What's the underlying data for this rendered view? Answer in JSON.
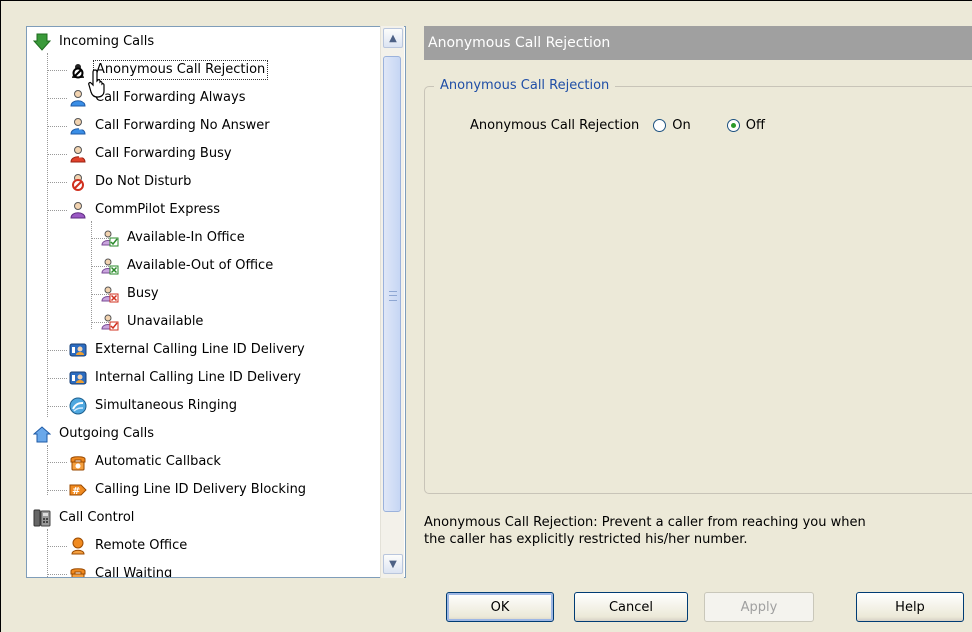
{
  "tree": {
    "items": [
      {
        "label": "Incoming Calls",
        "icon": "green-down-arrow-icon",
        "level": 0
      },
      {
        "label": "Anonymous Call Rejection",
        "icon": "anonymous-call-rejection-icon",
        "level": 1,
        "selected": true
      },
      {
        "label": "Call Forwarding Always",
        "icon": "call-forwarding-always-icon",
        "level": 1
      },
      {
        "label": "Call Forwarding No Answer",
        "icon": "call-forwarding-no-answer-icon",
        "level": 1
      },
      {
        "label": "Call Forwarding Busy",
        "icon": "call-forwarding-busy-icon",
        "level": 1
      },
      {
        "label": "Do Not Disturb",
        "icon": "do-not-disturb-icon",
        "level": 1
      },
      {
        "label": "CommPilot Express",
        "icon": "commpilot-express-icon",
        "level": 1
      },
      {
        "label": "Available-In Office",
        "icon": "available-in-office-icon",
        "level": 2
      },
      {
        "label": "Available-Out of Office",
        "icon": "available-out-of-office-icon",
        "level": 2
      },
      {
        "label": "Busy",
        "icon": "busy-icon",
        "level": 2
      },
      {
        "label": "Unavailable",
        "icon": "unavailable-icon",
        "level": 2
      },
      {
        "label": "External Calling Line ID Delivery",
        "icon": "external-calling-line-id-icon",
        "level": 1
      },
      {
        "label": "Internal Calling Line ID Delivery",
        "icon": "internal-calling-line-id-icon",
        "level": 1
      },
      {
        "label": "Simultaneous Ringing",
        "icon": "simultaneous-ringing-icon",
        "level": 1
      },
      {
        "label": "Outgoing Calls",
        "icon": "outgoing-calls-house-icon",
        "level": 0
      },
      {
        "label": "Automatic Callback",
        "icon": "automatic-callback-icon",
        "level": 1
      },
      {
        "label": "Calling Line ID Delivery Blocking",
        "icon": "calling-line-id-blocking-icon",
        "level": 1
      },
      {
        "label": "Call Control",
        "icon": "call-control-phone-icon",
        "level": 0
      },
      {
        "label": "Remote Office",
        "icon": "remote-office-icon",
        "level": 1
      },
      {
        "label": "Call Waiting",
        "icon": "call-waiting-icon",
        "level": 1
      }
    ]
  },
  "panel": {
    "header": "Anonymous Call Rejection",
    "group_title": "Anonymous Call Rejection",
    "option_label": "Anonymous Call Rejection",
    "option_on": "On",
    "option_off": "Off",
    "selected_option": "Off",
    "description_line1": "Anonymous Call Rejection: Prevent a caller from reaching you when",
    "description_line2": "the caller has explicitly restricted his/her number."
  },
  "buttons": {
    "ok": "OK",
    "cancel": "Cancel",
    "apply": "Apply",
    "help": "Help"
  },
  "colors": {
    "header_bg": "#a0a0a0",
    "group_title": "#1f4ea6",
    "window_bg": "#ece9d8"
  }
}
